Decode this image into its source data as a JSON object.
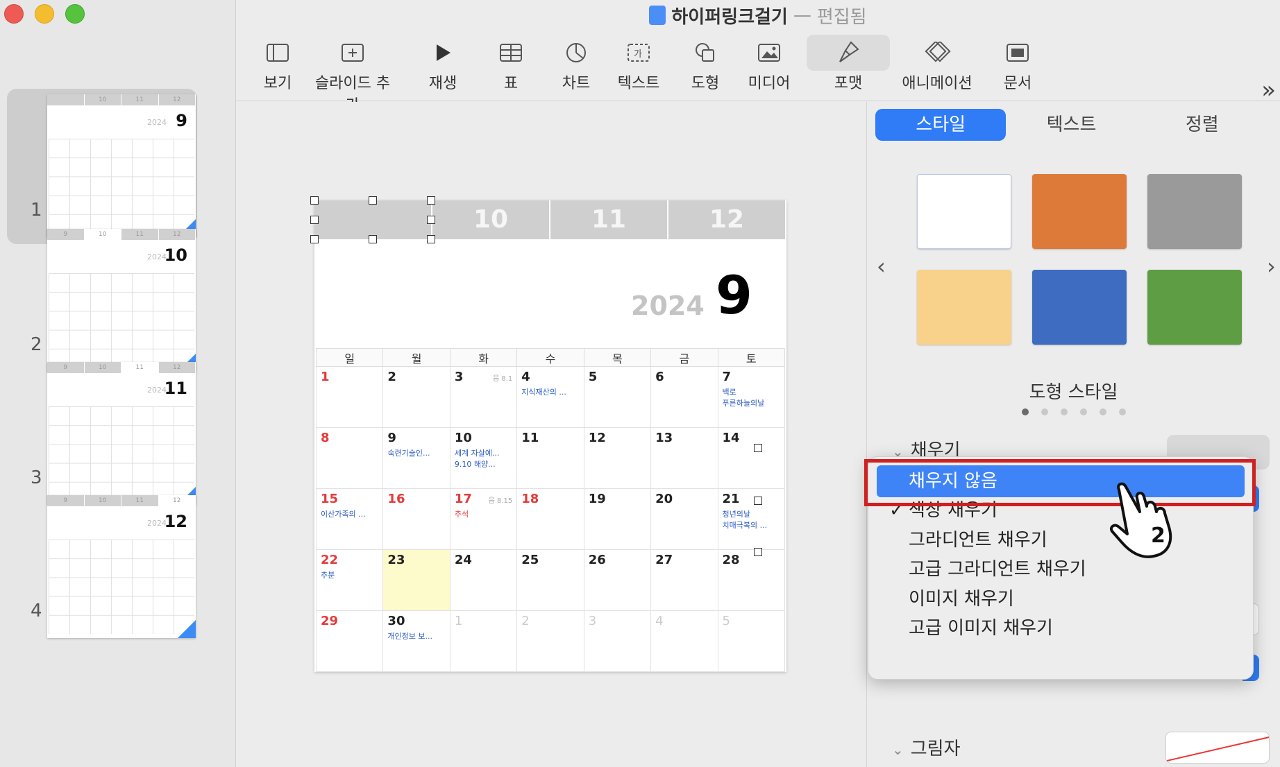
{
  "window": {
    "title": "하이퍼링크걸기",
    "separator": "—",
    "status": "편집됨"
  },
  "toolbar": {
    "items": [
      {
        "label": "보기",
        "icon": "sidebar-view-icon"
      },
      {
        "label": "슬라이드 추가",
        "icon": "add-slide-icon"
      },
      {
        "label": "재생",
        "icon": "play-icon"
      },
      {
        "label": "표",
        "icon": "table-icon"
      },
      {
        "label": "차트",
        "icon": "chart-icon"
      },
      {
        "label": "텍스트",
        "icon": "text-box-icon"
      },
      {
        "label": "도형",
        "icon": "shape-icon"
      },
      {
        "label": "미디어",
        "icon": "media-icon"
      },
      {
        "label": "포맷",
        "icon": "paintbrush-icon"
      },
      {
        "label": "애니메이션",
        "icon": "animation-icon"
      },
      {
        "label": "문서",
        "icon": "document-icon"
      }
    ],
    "more": "»"
  },
  "sidebar": {
    "slides": [
      {
        "number": "1",
        "year": "2024",
        "month": "9",
        "tabs": [
          "",
          "10",
          "11",
          "12"
        ]
      },
      {
        "number": "2",
        "year": "2024",
        "month": "10",
        "tabs": [
          "9",
          "10",
          "11",
          "12"
        ]
      },
      {
        "number": "3",
        "year": "2024",
        "month": "11",
        "tabs": [
          "9",
          "10",
          "11",
          "12"
        ]
      },
      {
        "number": "4",
        "year": "2024",
        "month": "12",
        "tabs": [
          "9",
          "10",
          "11",
          "12"
        ]
      }
    ]
  },
  "slide": {
    "tabs": [
      "",
      "10",
      "11",
      "12"
    ],
    "year": "2024",
    "month": "9",
    "weekdays": [
      "일",
      "월",
      "화",
      "수",
      "목",
      "금",
      "토"
    ],
    "weeks": [
      [
        {
          "d": "1",
          "c": "red"
        },
        {
          "d": "2"
        },
        {
          "d": "3",
          "lunar": "음 8.1"
        },
        {
          "d": "4",
          "ev": "지식재산의 ..."
        },
        {
          "d": "5"
        },
        {
          "d": "6"
        },
        {
          "d": "7",
          "ev": "백로\n푸른하늘의날"
        }
      ],
      [
        {
          "d": "8",
          "c": "red"
        },
        {
          "d": "9",
          "ev": "숙련기술인..."
        },
        {
          "d": "10",
          "ev": "세계 자살예...\n9.10 해양..."
        },
        {
          "d": "11"
        },
        {
          "d": "12"
        },
        {
          "d": "13"
        },
        {
          "d": "14"
        }
      ],
      [
        {
          "d": "15",
          "c": "red",
          "ev": "이산가족의 ..."
        },
        {
          "d": "16",
          "c": "red"
        },
        {
          "d": "17",
          "c": "red",
          "lunar": "음 8.15",
          "ev": "추석",
          "evc": "red"
        },
        {
          "d": "18",
          "c": "red"
        },
        {
          "d": "19"
        },
        {
          "d": "20"
        },
        {
          "d": "21",
          "ev": "청년의날\n치매극복의 ..."
        }
      ],
      [
        {
          "d": "22",
          "c": "red",
          "ev": "추분"
        },
        {
          "d": "23",
          "today": true
        },
        {
          "d": "24"
        },
        {
          "d": "25"
        },
        {
          "d": "26"
        },
        {
          "d": "27"
        },
        {
          "d": "28"
        }
      ],
      [
        {
          "d": "29",
          "c": "red"
        },
        {
          "d": "30",
          "ev": "개인정보 보..."
        },
        {
          "d": "1",
          "c": "gray"
        },
        {
          "d": "2",
          "c": "gray"
        },
        {
          "d": "3",
          "c": "gray"
        },
        {
          "d": "4",
          "c": "gray"
        },
        {
          "d": "5",
          "c": "gray"
        }
      ]
    ]
  },
  "panel": {
    "tabs": [
      "스타일",
      "텍스트",
      "정렬"
    ],
    "swatches": [
      "#ffffff",
      "#dd7a3a",
      "#9a9a9a",
      "#f8d28a",
      "#3e6cc0",
      "#5e9d44"
    ],
    "shape_style_label": "도형 스타일",
    "fill_label": "채우기",
    "shadow_label": "그림자",
    "prev": "‹",
    "next": "›"
  },
  "fill_menu": {
    "items": [
      {
        "label": "채우지 않음",
        "highlighted": true,
        "checked": false
      },
      {
        "label": "색상 채우기",
        "highlighted": false,
        "checked": true
      },
      {
        "label": "그라디언트 채우기",
        "highlighted": false,
        "checked": false
      },
      {
        "label": "고급 그라디언트 채우기",
        "highlighted": false,
        "checked": false
      },
      {
        "label": "이미지 채우기",
        "highlighted": false,
        "checked": false
      },
      {
        "label": "고급 이미지 채우기",
        "highlighted": false,
        "checked": false
      }
    ],
    "check_glyph": "✓"
  },
  "annotation": {
    "step": "2"
  }
}
